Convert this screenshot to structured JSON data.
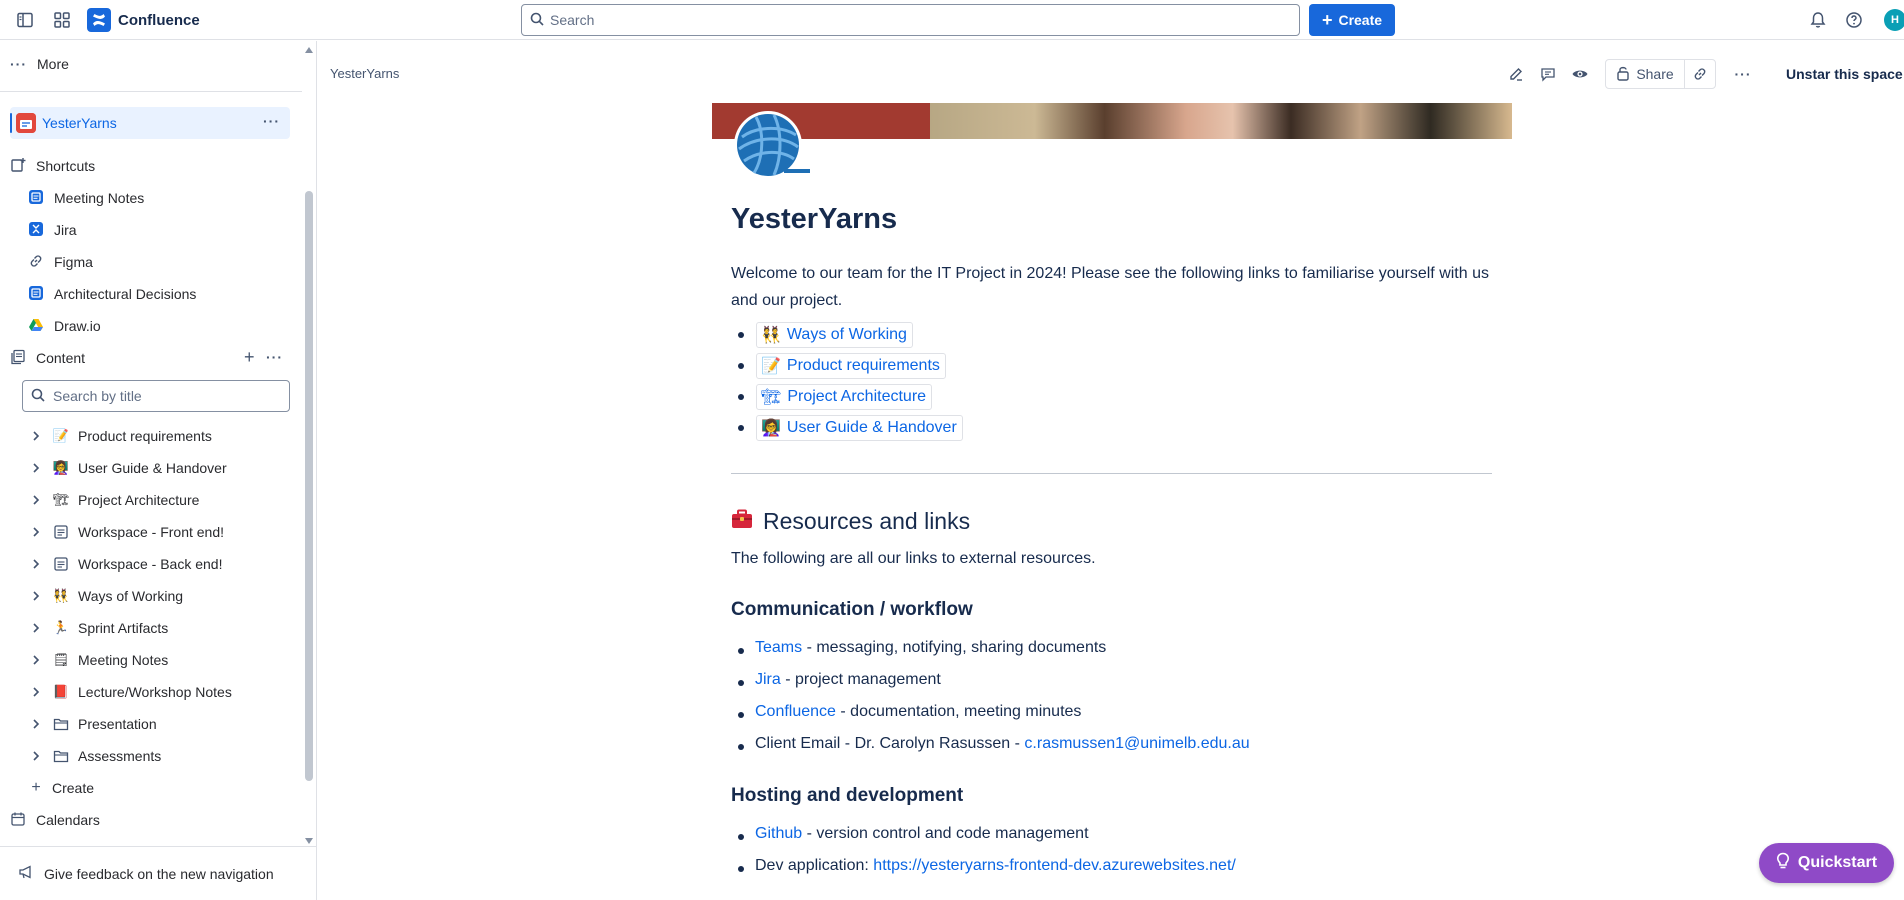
{
  "topbar": {
    "app_name": "Confluence",
    "search_placeholder": "Search",
    "create_label": "Create",
    "avatar_initial": "H",
    "brand_color": "#1868db"
  },
  "sidebar": {
    "more_label": "More",
    "space_name": "YesterYarns",
    "shortcuts_label": "Shortcuts",
    "shortcuts": [
      {
        "label": "Meeting Notes",
        "icon": "confluence-page-icon"
      },
      {
        "label": "Jira",
        "icon": "jira-icon"
      },
      {
        "label": "Figma",
        "icon": "link-icon"
      },
      {
        "label": "Architectural Decisions",
        "icon": "confluence-page-icon"
      },
      {
        "label": "Draw.io",
        "icon": "google-drive-icon"
      }
    ],
    "content_label": "Content",
    "search_placeholder": "Search by title",
    "tree": [
      {
        "label": "Product requirements",
        "icon": "memo-emoji"
      },
      {
        "label": "User Guide & Handover",
        "icon": "teacher-emoji"
      },
      {
        "label": "Project Architecture",
        "icon": "crane-emoji"
      },
      {
        "label": "Workspace - Front end!",
        "icon": "page-icon"
      },
      {
        "label": "Workspace - Back end!",
        "icon": "page-icon"
      },
      {
        "label": "Ways of Working",
        "icon": "people-emoji"
      },
      {
        "label": "Sprint Artifacts",
        "icon": "runner-emoji"
      },
      {
        "label": "Meeting Notes",
        "icon": "notepad-emoji"
      },
      {
        "label": "Lecture/Workshop Notes",
        "icon": "book-emoji"
      },
      {
        "label": "Presentation",
        "icon": "folder-icon"
      },
      {
        "label": "Assessments",
        "icon": "folder-icon"
      }
    ],
    "create_label": "Create",
    "calendars_label": "Calendars",
    "feedback_label": "Give feedback on the new navigation"
  },
  "page": {
    "breadcrumb": "YesterYarns",
    "share_label": "Share",
    "unstar_label": "Unstar this space",
    "title": "YesterYarns",
    "intro": "Welcome to our team for the IT Project in 2024! Please see the following links to familiarise yourself with us and our project.",
    "links": [
      {
        "label": "Ways of Working",
        "emoji": "👯"
      },
      {
        "label": "Product requirements",
        "emoji": "📝"
      },
      {
        "label": "Project Architecture",
        "emoji": "🏗"
      },
      {
        "label": "User Guide & Handover",
        "emoji": "👩‍🏫"
      }
    ],
    "resources_heading": "Resources and links",
    "resources_intro": "The following are all our links to external resources.",
    "comm_heading": "Communication / workflow",
    "comm_items": [
      {
        "link": "Teams",
        "text": " - messaging, notifying, sharing documents"
      },
      {
        "link": "Jira",
        "text": " - project management"
      },
      {
        "link": "Confluence",
        "text": " - documentation, meeting minutes"
      },
      {
        "prefix": "Client Email - Dr. Carolyn Rasussen - ",
        "link": "c.rasmussen1@unimelb.edu.au"
      }
    ],
    "hosting_heading": "Hosting and development",
    "hosting_items": [
      {
        "link": "Github",
        "text": " - version control and code management"
      },
      {
        "prefix": "Dev application: ",
        "link": "https://yesteryarns-frontend-dev.azurewebsites.net/"
      }
    ]
  },
  "quickstart_label": "Quickstart"
}
